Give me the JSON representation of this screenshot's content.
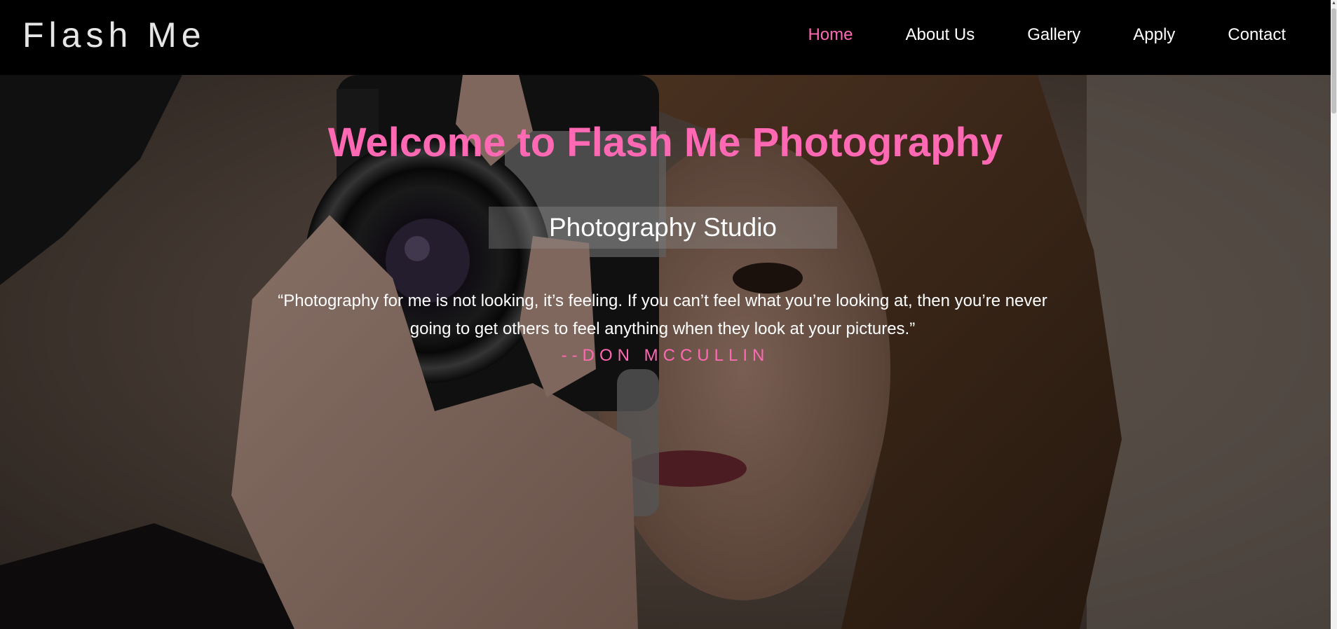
{
  "header": {
    "brand": "Flash Me",
    "nav": [
      {
        "label": "Home",
        "active": true
      },
      {
        "label": "About Us",
        "active": false
      },
      {
        "label": "Gallery",
        "active": false
      },
      {
        "label": "Apply",
        "active": false
      },
      {
        "label": "Contact",
        "active": false
      }
    ]
  },
  "hero": {
    "title": "Welcome to Flash Me Photography",
    "subtitle": "Photography Studio",
    "quote_line1": "“Photography for me is not looking, it’s feeling. If you can’t feel what you’re looking at, then you’re never",
    "quote_line2": "going to get others to feel anything when they look at your pictures.”",
    "quote_author": "--DON MCCULLIN",
    "background_image": "woman-holding-camera-photo"
  },
  "colors": {
    "accent": "#ff69b4",
    "nav_background": "#000000",
    "text": "#ffffff"
  }
}
